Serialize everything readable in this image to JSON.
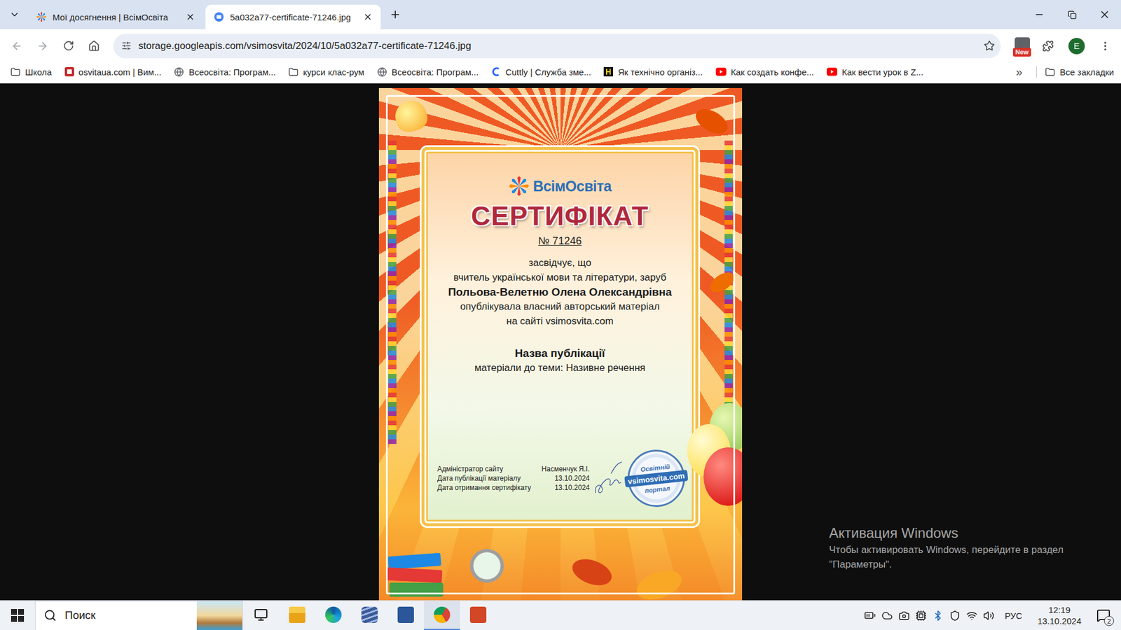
{
  "tabs": [
    {
      "title": "Мої досягнення | ВсімОсвіта",
      "kind": "vsimosvita",
      "selected": false
    },
    {
      "title": "5a032a77-certificate-71246.jpg",
      "kind": "image",
      "selected": true
    }
  ],
  "address": "storage.googleapis.com/vsimosvita/2024/10/5a032a77-certificate-71246.jpg",
  "extension_badge": "New",
  "profile": "E",
  "bookmarks": [
    {
      "label": "Школа",
      "kind": "folder"
    },
    {
      "label": "osvitaua.com | Вим...",
      "kind": "osvita"
    },
    {
      "label": "Всеосвіта: Програм...",
      "kind": "globe"
    },
    {
      "label": "курси клас-рум",
      "kind": "folder"
    },
    {
      "label": "Всеосвіта: Програм...",
      "kind": "globe"
    },
    {
      "label": "Cuttly | Служба зме...",
      "kind": "cuttly"
    },
    {
      "label": "Як технічно організ...",
      "kind": "tech"
    },
    {
      "label": "Как создать конфе...",
      "kind": "youtube"
    },
    {
      "label": "Как вести урок в Z...",
      "kind": "youtube"
    }
  ],
  "bookmarks_more": "»",
  "all_bookmarks": "Все закладки",
  "certificate": {
    "logo": "ВсімОсвіта",
    "title": "СЕРТИФІКАТ",
    "number": "№ 71246",
    "lines": [
      "засвідчує, що",
      "вчитель української мови та літератури, заруб"
    ],
    "name": "Польова-Велетню Олена Олександрівна",
    "lines_after": [
      "опублікувала власний авторський матеріал",
      "на сайті vsimosvita.com"
    ],
    "publication_label": "Назва публікації",
    "publication": "матеріали до теми: Називне речення",
    "footer": [
      {
        "label": "Адміністратор сайту",
        "value": "Насменчук Я.І."
      },
      {
        "label": "Дата публікації матеріалу",
        "value": "13.10.2024"
      },
      {
        "label": "Дата отримання сертифікату",
        "value": "13.10.2024"
      }
    ],
    "stamp": {
      "top": "Освітній",
      "band": "vsimosvita.com",
      "bottom": "портал"
    }
  },
  "watermark": {
    "title": "Активация Windows",
    "text_lines": [
      "Чтобы активировать Windows, перейдите в раздел",
      "\"Параметры\"."
    ]
  },
  "taskbar": {
    "search": "Поиск",
    "apps": [
      {
        "kind": "taskview",
        "active": false
      },
      {
        "kind": "explorer",
        "active": false
      },
      {
        "kind": "edge",
        "active": false
      },
      {
        "kind": "stack",
        "active": false
      },
      {
        "kind": "word",
        "active": false
      },
      {
        "kind": "chrome",
        "active": true
      },
      {
        "kind": "powerpoint",
        "active": false
      }
    ],
    "language": "РУС",
    "time": "12:19",
    "date": "13.10.2024",
    "notifications": "2"
  }
}
